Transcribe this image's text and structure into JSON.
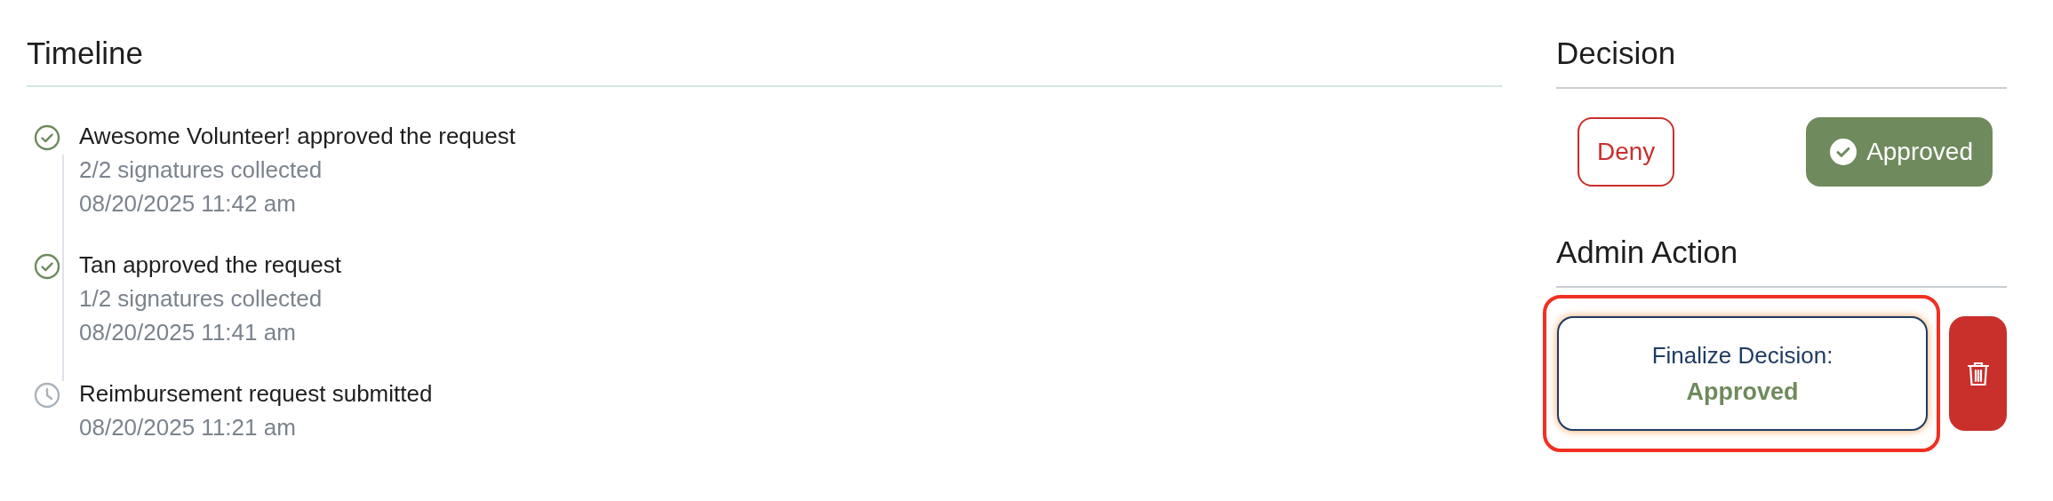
{
  "timeline": {
    "title": "Timeline",
    "events": [
      {
        "kind": "approved",
        "title": "Awesome Volunteer! approved the request",
        "detail": "2/2 signatures collected",
        "time": "08/20/2025 11:42 am"
      },
      {
        "kind": "approved",
        "title": "Tan approved the request",
        "detail": "1/2 signatures collected",
        "time": "08/20/2025 11:41 am"
      },
      {
        "kind": "submitted",
        "title": "Reimbursement request submitted",
        "time": "08/20/2025 11:21 am"
      }
    ]
  },
  "decision": {
    "title": "Decision",
    "options": [
      {
        "kind": "deny",
        "label": "Deny",
        "selected": false
      },
      {
        "kind": "approve",
        "label": "Approved",
        "selected": true
      }
    ]
  },
  "admin_action": {
    "title": "Admin Action",
    "highlighted": true,
    "finalize": {
      "label": "Finalize Decision:",
      "decision": "Approved"
    }
  }
}
